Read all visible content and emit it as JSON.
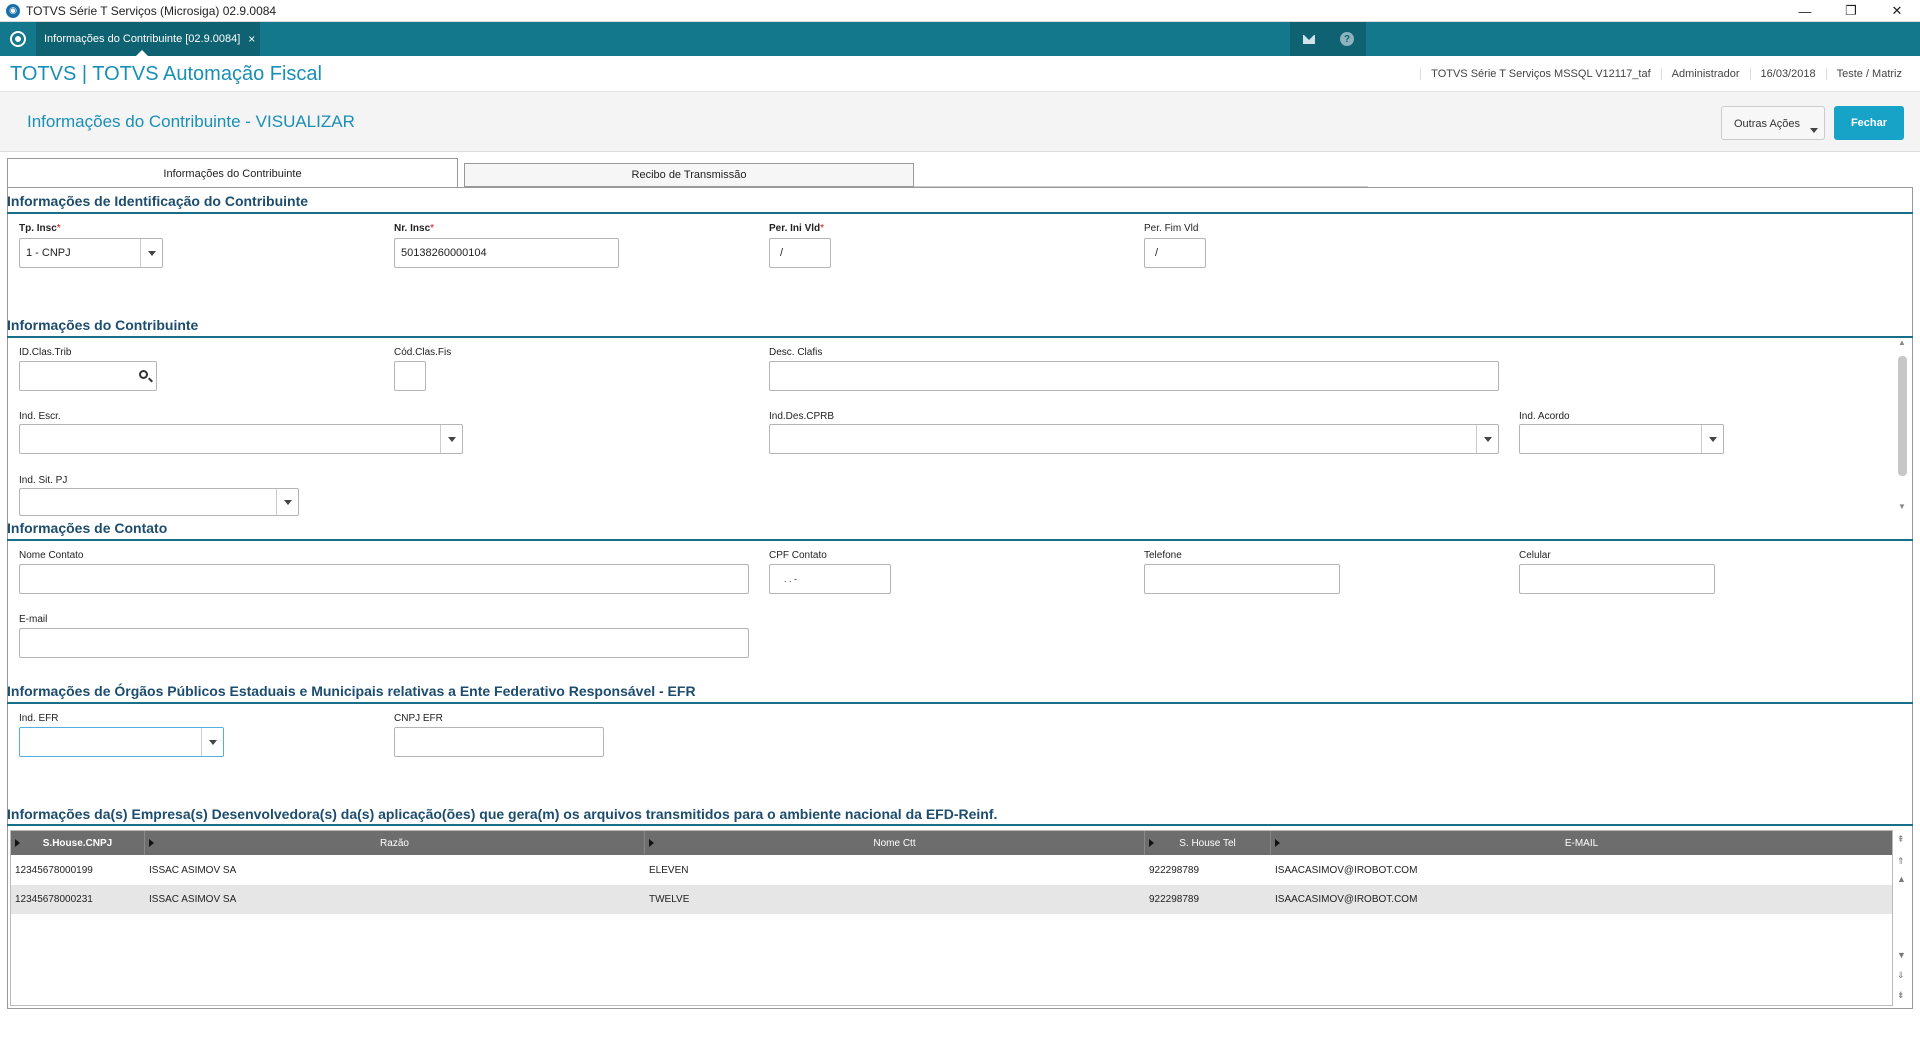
{
  "window": {
    "title": "TOTVS Série T Serviços (Microsiga) 02.9.0084",
    "minimize": "—",
    "maximize": "❐",
    "close": "✕"
  },
  "tabstrip": {
    "doc_tab": "Informações do Contribuinte [02.9.0084]",
    "doc_tab_close": "×",
    "help": "?"
  },
  "brand": {
    "title": "TOTVS | TOTVS Automação Fiscal",
    "environment": "TOTVS Série T Serviços MSSQL V12117_taf",
    "user": "Administrador",
    "date": "16/03/2018",
    "branch": "Teste / Matriz"
  },
  "page": {
    "title": "Informações do Contribuinte - VISUALIZAR",
    "other_actions": "Outras Ações",
    "close": "Fechar"
  },
  "tabs": [
    "Informações do Contribuinte",
    "Recibo de Transmissão"
  ],
  "sections": {
    "identificacao": {
      "title": "Informações de Identificação do Contribuinte",
      "tp_insc_label": "Tp. Insc",
      "tp_insc_value": "1 - CNPJ",
      "nr_insc_label": "Nr. Insc",
      "nr_insc_value": "50138260000104",
      "per_ini_label": "Per. Ini Vld",
      "per_ini_value": "/",
      "per_fim_label": "Per. Fim Vld",
      "per_fim_value": "/",
      "required_mark": "*"
    },
    "contribuinte": {
      "title": "Informações do Contribuinte",
      "id_clas_trib": "ID.Clas.Trib",
      "cod_clas_fis": "Cód.Clas.Fis",
      "desc_clafis": "Desc. Clafis",
      "ind_escr": "Ind. Escr.",
      "ind_des_cprb": "Ind.Des.CPRB",
      "ind_acordo": "Ind. Acordo",
      "ind_sit_pj": "Ind. Sit. PJ"
    },
    "contato": {
      "title": "Informações de Contato",
      "nome_contato": "Nome Contato",
      "cpf_contato": "CPF Contato",
      "cpf_mask": ".   .   -",
      "telefone": "Telefone",
      "celular": "Celular",
      "email": "E-mail"
    },
    "efr": {
      "title": "Informações de Órgãos Públicos Estaduais e Municipais relativas a Ente Federativo Responsável - EFR",
      "ind_efr": "Ind. EFR",
      "cnpj_efr": "CNPJ EFR"
    },
    "software_house": {
      "title": "Informações da(s) Empresa(s) Desenvolvedora(s) da(s) aplicação(ões) que gera(m) os arquivos transmitidos para o ambiente nacional da EFD-Reinf.",
      "columns": [
        "S.House.CNPJ",
        "Razão",
        "Nome Ctt",
        "S. House Tel",
        "E-MAIL"
      ],
      "rows": [
        [
          "12345678000199",
          "ISSAC ASIMOV SA",
          "ELEVEN",
          "922298789",
          "ISAACASIMOV@IROBOT.COM"
        ],
        [
          "12345678000231",
          "ISSAC ASIMOV SA",
          "TWELVE",
          "922298789",
          "ISAACASIMOV@IROBOT.COM"
        ]
      ]
    }
  },
  "colors": {
    "accent": "#13788b",
    "brand_text": "#1a8fb5",
    "primary_button": "#17a3c8",
    "grid_header": "#6d6d6d"
  }
}
